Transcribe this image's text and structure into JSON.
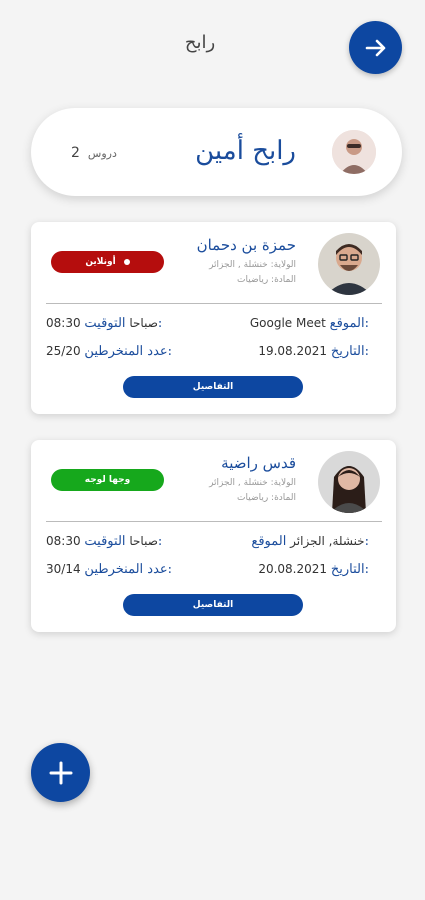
{
  "header": {
    "title": "رابح"
  },
  "profile": {
    "name": "رابح أمين",
    "lessons_count": "2",
    "lessons_label": "دروس"
  },
  "lessons": [
    {
      "teacher": "حمزة بن دحمان",
      "state_line": "الولاية: خنشلة , الجزائر",
      "subject_line": "المادة: رياضيات",
      "badge": "أونلاين",
      "badge_color": "#b50d0d",
      "location_label": "الموقع:",
      "location": "Google Meet",
      "time_label": "التوقيت:",
      "time": "08:30 صباحا",
      "date_label": "التاريخ:",
      "date": "19.08.2021",
      "enrolled_label": "عدد المنخرطين:",
      "enrolled": "25/20",
      "details_label": "التفاصيل"
    },
    {
      "teacher": "قدس راضية",
      "state_line": "الولاية: خنشلة , الجزائر",
      "subject_line": "المادة: رياضيات",
      "badge": "وجها لوجه",
      "badge_color": "#16a81c",
      "location_label": "الموقع:",
      "location": "خنشلة, الجزائر",
      "time_label": "التوقيت:",
      "time": "08:30 صباحا",
      "date_label": "التاريخ:",
      "date": "20.08.2021",
      "enrolled_label": "عدد المنخرطين:",
      "enrolled": "30/14",
      "details_label": "التفاصيل"
    }
  ],
  "icons": {
    "header_action": "arrow-right-icon",
    "fab": "plus-icon"
  },
  "colors": {
    "accent": "#0d47a1",
    "online": "#b50d0d",
    "in_person": "#16a81c"
  }
}
